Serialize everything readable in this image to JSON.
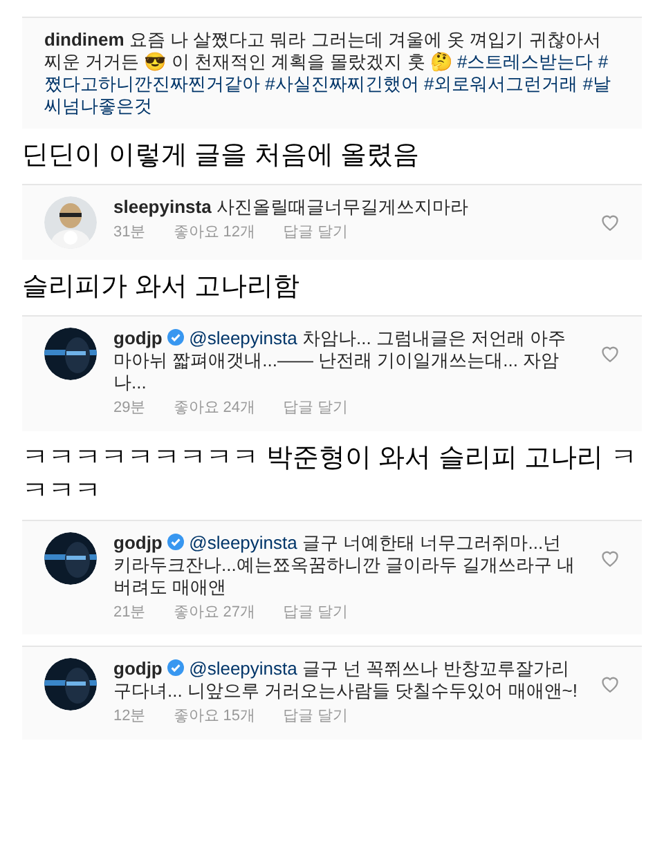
{
  "blocks": [
    {
      "kind": "post",
      "username": "dindinem",
      "text": "요즘 나 살쪘다고 뭐라 그러는데 겨울에 옷 껴입기 귀찮아서 찌운 거거든 😎 이 천재적인 계획을 몰랐겠지 훗 🤔 ",
      "hashtags": [
        "#스트레스받는다",
        "#쪘다고하니깐진짜찐거같아",
        "#사실진짜찌긴했어",
        "#외로워서그런거래",
        "#날씨넘나좋은것"
      ]
    },
    {
      "kind": "caption",
      "text": "딘딘이 이렇게 글을 처음에 올렸음"
    },
    {
      "kind": "comment",
      "username": "sleepyinsta",
      "verified": false,
      "text": "사진올릴때글너무길게쓰지마라",
      "time": "31분",
      "likes": "좋아요 12개",
      "reply": "답글 달기"
    },
    {
      "kind": "caption",
      "text": "슬리피가 와서 고나리함"
    },
    {
      "kind": "comment",
      "username": "godjp",
      "verified": true,
      "mention": "@sleepyinsta",
      "text": "차암나... 그럼내글은 저언래 아주마아뉘 짧펴애갯내...—— 난전래 기이일개쓰는대... 자암나...",
      "time": "29분",
      "likes": "좋아요 24개",
      "reply": "답글 달기"
    },
    {
      "kind": "caption",
      "text": "ㅋㅋㅋㅋㅋㅋㅋㅋㅋ 박준형이 와서 슬리피 고나리 ㅋㅋㅋㅋ"
    },
    {
      "kind": "comment",
      "username": "godjp",
      "verified": true,
      "mention": "@sleepyinsta",
      "text": "글구 너예한태 너무그러쥐마...넌 키라두크잔나...예는쬬옥꿈하니깐 글이라두 길개쓰라구 내버려도 매애앤",
      "time": "21분",
      "likes": "좋아요 27개",
      "reply": "답글 달기"
    },
    {
      "kind": "comment",
      "username": "godjp",
      "verified": true,
      "mention": "@sleepyinsta",
      "text": "글구 넌 꼭쮜쓰나 반창꼬루잘가리구다녀... 니앞으루 거러오는사람들 닷칠수두있어 매애앤~!",
      "time": "12분",
      "likes": "좋아요 15개",
      "reply": "답글 달기"
    }
  ]
}
